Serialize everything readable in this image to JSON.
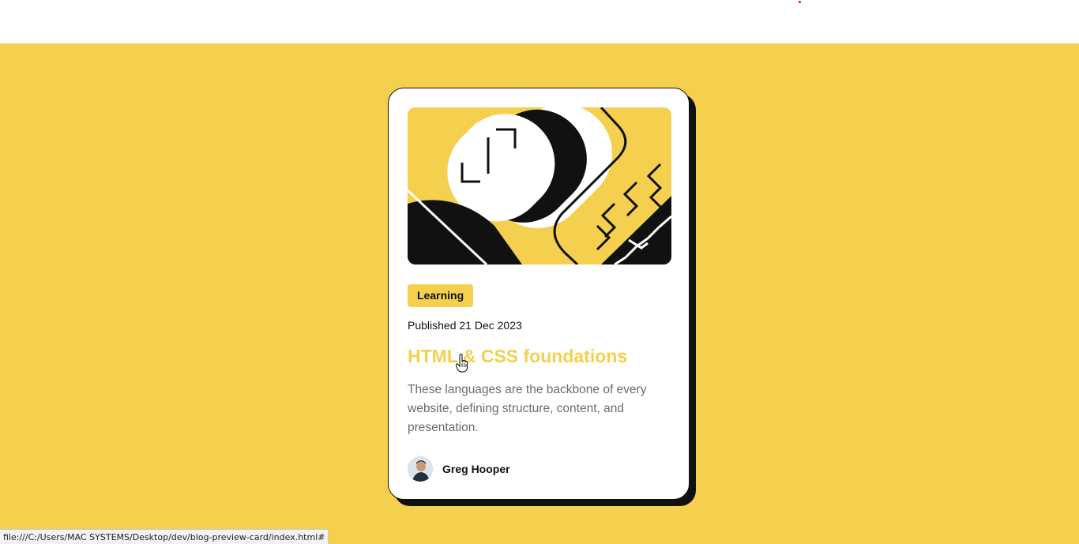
{
  "colors": {
    "background": "#f4d04e",
    "card": "#ffffff",
    "ink": "#111111",
    "muted": "#6b6b6b",
    "accent": "#f4d04e"
  },
  "card": {
    "hero_image": "illustration-article",
    "tag": "Learning",
    "published": "Published 21 Dec 2023",
    "title": "HTML & CSS foundations",
    "description": "These languages are the backbone of every website, defining structure, content, and presentation.",
    "author": {
      "name": "Greg Hooper",
      "avatar_icon": "avatar-image"
    }
  },
  "cursor_icon": "hand-pointer-icon",
  "status_bar": {
    "url": "file:///C:/Users/MAC SYSTEMS/Desktop/dev/blog-preview-card/index.html#"
  }
}
